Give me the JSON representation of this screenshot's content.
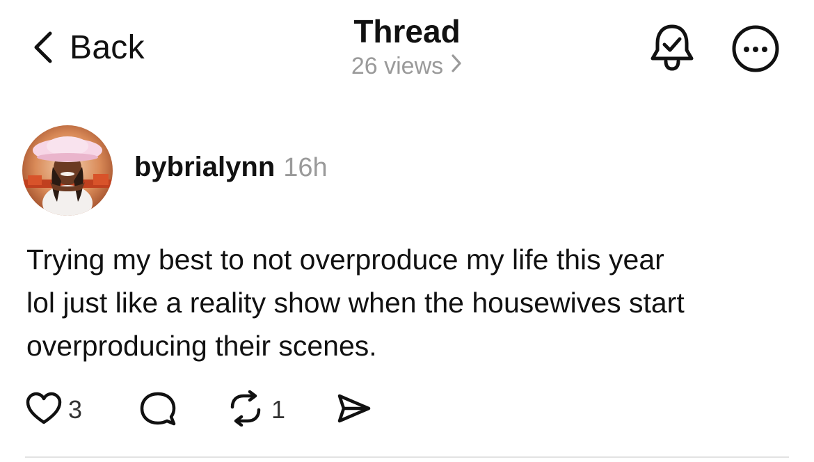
{
  "header": {
    "back_label": "Back",
    "title": "Thread",
    "views": "26 views"
  },
  "post": {
    "author": "bybrialynn",
    "time": "16h",
    "text": "Trying my best to not overproduce my life this year\nlol just like a reality show when the housewives start\noverproducing their scenes.",
    "likes": "3",
    "reposts": "1"
  },
  "icons": {
    "back": "chevron-left-icon",
    "views": "chevron-right-icon",
    "bell": "bell-check-icon",
    "more": "more-circle-icon",
    "like": "heart-icon",
    "reply": "speech-bubble-icon",
    "repost": "repost-icon",
    "share": "send-icon"
  },
  "colors": {
    "text": "#111111",
    "secondary": "#9a9a9a",
    "divider": "#e2e2e2"
  }
}
